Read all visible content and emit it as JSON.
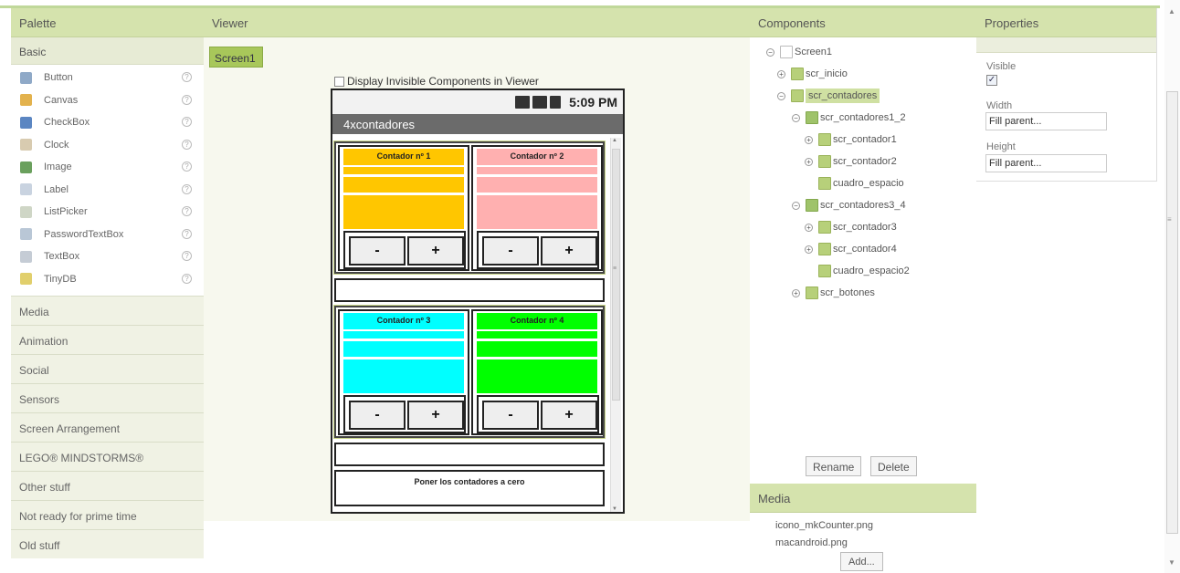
{
  "palette": {
    "title": "Palette",
    "basic_label": "Basic",
    "items": [
      {
        "label": "Button",
        "icon": "button-icon",
        "color": "#8fa9c7"
      },
      {
        "label": "Canvas",
        "icon": "canvas-icon",
        "color": "#e3b24d"
      },
      {
        "label": "CheckBox",
        "icon": "checkbox-icon",
        "color": "#5b86c2"
      },
      {
        "label": "Clock",
        "icon": "clock-icon",
        "color": "#d8cbb0"
      },
      {
        "label": "Image",
        "icon": "image-icon",
        "color": "#6aa05d"
      },
      {
        "label": "Label",
        "icon": "label-icon",
        "color": "#c9d3e0"
      },
      {
        "label": "ListPicker",
        "icon": "listpicker-icon",
        "color": "#cfd6c6"
      },
      {
        "label": "PasswordTextBox",
        "icon": "password-icon",
        "color": "#b9c7d6"
      },
      {
        "label": "TextBox",
        "icon": "textbox-icon",
        "color": "#c5ccd5"
      },
      {
        "label": "TinyDB",
        "icon": "database-icon",
        "color": "#e1cf6c"
      }
    ],
    "help_glyph": "?",
    "categories": [
      "Media",
      "Animation",
      "Social",
      "Sensors",
      "Screen Arrangement",
      "LEGO® MINDSTORMS®",
      "Other stuff",
      "Not ready for prime time",
      "Old stuff"
    ]
  },
  "viewer": {
    "title": "Viewer",
    "screen_tab": "Screen1",
    "invisible_label": "Display Invisible Components in Viewer",
    "phone": {
      "time": "5:09 PM",
      "app_title": "4xcontadores",
      "counters": [
        {
          "label": "Contador nº 1",
          "color": "#ffc600"
        },
        {
          "label": "Contador nº 2",
          "color": "#ffb0b0"
        },
        {
          "label": "Contador nº 3",
          "color": "#00ffff"
        },
        {
          "label": "Contador nº 4",
          "color": "#00ff00"
        }
      ],
      "minus_label": "-",
      "plus_label": "+",
      "reset_label": "Poner los contadores a cero"
    }
  },
  "components": {
    "title": "Components",
    "tree": [
      {
        "label": "Screen1",
        "expander": "⊟",
        "type": "screen"
      },
      {
        "label": "scr_inicio",
        "expander": "⊞",
        "type": "arr"
      },
      {
        "label": "scr_contadores",
        "expander": "⊟",
        "type": "arr",
        "selected": true
      },
      {
        "label": "scr_contadores1_2",
        "expander": "⊟",
        "type": "harr"
      },
      {
        "label": "scr_contador1",
        "expander": "⊞",
        "type": "arr"
      },
      {
        "label": "scr_contador2",
        "expander": "⊞",
        "type": "arr"
      },
      {
        "label": "cuadro_espacio",
        "expander": "",
        "type": "arr"
      },
      {
        "label": "scr_contadores3_4",
        "expander": "⊟",
        "type": "harr"
      },
      {
        "label": "scr_contador3",
        "expander": "⊞",
        "type": "arr"
      },
      {
        "label": "scr_contador4",
        "expander": "⊞",
        "type": "arr"
      },
      {
        "label": "cuadro_espacio2",
        "expander": "",
        "type": "arr"
      },
      {
        "label": "scr_botones",
        "expander": "⊞",
        "type": "arr"
      }
    ],
    "rename_label": "Rename",
    "delete_label": "Delete"
  },
  "media": {
    "title": "Media",
    "files": [
      "icono_mkCounter.png",
      "macandroid.png"
    ],
    "add_label": "Add..."
  },
  "properties": {
    "title": "Properties",
    "visible_label": "Visible",
    "visible_checked": true,
    "width_label": "Width",
    "width_value": "Fill parent...",
    "height_label": "Height",
    "height_value": "Fill parent..."
  }
}
